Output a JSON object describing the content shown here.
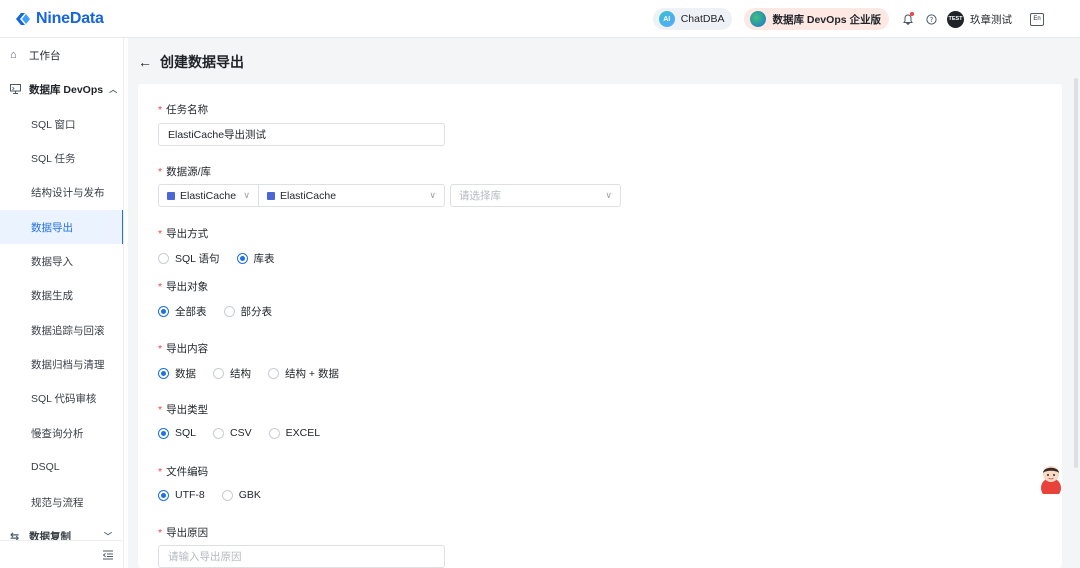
{
  "brand": {
    "name": "NineData"
  },
  "header": {
    "chat_label": "ChatDBA",
    "chat_badge": "AI",
    "edition_label": "数据库 DevOps 企业版",
    "user_badge": "TEST",
    "user_name": "玖章测试",
    "lang_badge": "En"
  },
  "sidebar": {
    "workbench": "工作台",
    "section": "数据库 DevOps",
    "items": [
      "SQL 窗口",
      "SQL 任务",
      "结构设计与发布",
      "数据导出",
      "数据导入",
      "数据生成",
      "数据追踪与回滚",
      "数据归档与清理",
      "SQL 代码审核",
      "慢查询分析",
      "DSQL",
      "规范与流程"
    ],
    "next_section": "数据复制",
    "active": "数据导出"
  },
  "page": {
    "title": "创建数据导出",
    "task_name_label": "任务名称",
    "task_name_value": "ElastiCache导出测试",
    "source_label": "数据源/库",
    "source_type": "ElastiCache",
    "source_instance": "ElastiCache",
    "db_placeholder": "请选择库",
    "method_label": "导出方式",
    "method_options": [
      "SQL 语句",
      "库表"
    ],
    "method_selected": "库表",
    "object_label": "导出对象",
    "object_options": [
      "全部表",
      "部分表"
    ],
    "object_selected": "全部表",
    "content_label": "导出内容",
    "content_options": [
      "数据",
      "结构",
      "结构 + 数据"
    ],
    "content_selected": "数据",
    "type_label": "导出类型",
    "type_options": [
      "SQL",
      "CSV",
      "EXCEL"
    ],
    "type_selected": "SQL",
    "encoding_label": "文件编码",
    "encoding_options": [
      "UTF-8",
      "GBK"
    ],
    "encoding_selected": "UTF-8",
    "reason_label": "导出原因",
    "reason_placeholder": "请输入导出原因"
  },
  "colors": {
    "primary": "#1f6fe5",
    "brand": "#1565e0",
    "required": "#f53f3f"
  }
}
